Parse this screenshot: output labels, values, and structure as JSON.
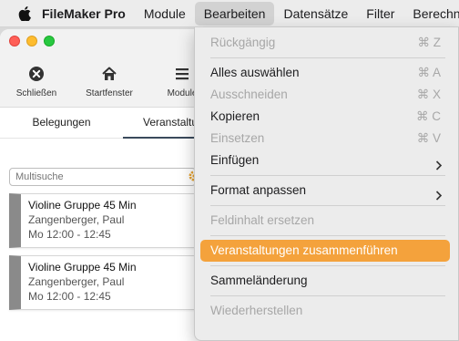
{
  "menubar": {
    "app_name": "FileMaker Pro",
    "items": [
      "Module",
      "Bearbeiten",
      "Datensätze",
      "Filter",
      "Berechn"
    ]
  },
  "toolbar": {
    "close_label": "Schließen",
    "home_label": "Startfenster",
    "module_label": "Module"
  },
  "tabs": [
    "Belegungen",
    "Veranstaltun"
  ],
  "search": {
    "placeholder": "Multisuche"
  },
  "cards": [
    {
      "title": "Violine Gruppe 45 Min",
      "person": "Zangenberger, Paul",
      "time": "Mo 12:00 - 12:45"
    },
    {
      "title": "Violine Gruppe 45 Min",
      "person": "Zangenberger, Paul",
      "time": "Mo 12:00 - 12:45"
    }
  ],
  "dropdown": {
    "undo": {
      "label": "Rückgängig",
      "shortcut": "⌘ Z"
    },
    "select_all": {
      "label": "Alles auswählen",
      "shortcut": "⌘ A"
    },
    "cut": {
      "label": "Ausschneiden",
      "shortcut": "⌘ X"
    },
    "copy": {
      "label": "Kopieren",
      "shortcut": "⌘ C"
    },
    "paste": {
      "label": "Einsetzen",
      "shortcut": "⌘ V"
    },
    "insert": {
      "label": "Einfügen"
    },
    "format": {
      "label": "Format anpassen"
    },
    "replace": {
      "label": "Feldinhalt ersetzen"
    },
    "merge": {
      "label": "Veranstaltungen zusammenführen"
    },
    "batch": {
      "label": "Sammeländerung"
    },
    "restore": {
      "label": "Wiederherstellen"
    }
  },
  "colors": {
    "highlight": "#f4a23c",
    "card_stripe": "#8a8a8a"
  }
}
